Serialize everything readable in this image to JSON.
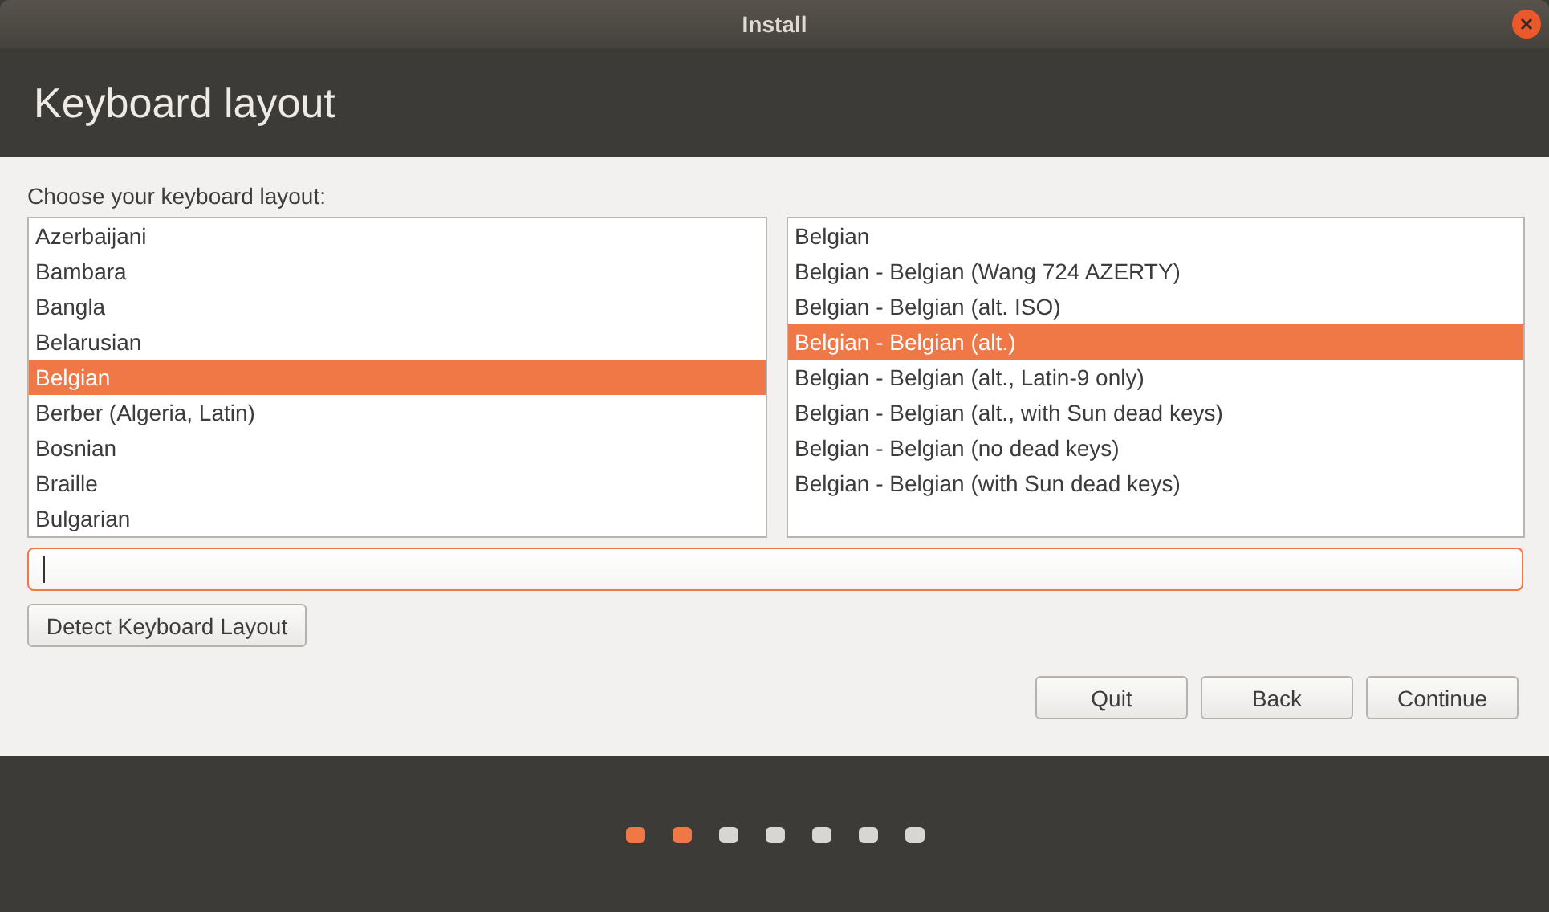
{
  "window": {
    "title": "Install"
  },
  "page_title": "Keyboard layout",
  "prompt": "Choose your keyboard layout:",
  "layouts": [
    {
      "label": "Azerbaijani",
      "selected": false
    },
    {
      "label": "Bambara",
      "selected": false
    },
    {
      "label": "Bangla",
      "selected": false
    },
    {
      "label": "Belarusian",
      "selected": false
    },
    {
      "label": "Belgian",
      "selected": true
    },
    {
      "label": "Berber (Algeria, Latin)",
      "selected": false
    },
    {
      "label": "Bosnian",
      "selected": false
    },
    {
      "label": "Braille",
      "selected": false
    },
    {
      "label": "Bulgarian",
      "selected": false
    }
  ],
  "variants": [
    {
      "label": "Belgian",
      "selected": false
    },
    {
      "label": "Belgian - Belgian (Wang 724 AZERTY)",
      "selected": false
    },
    {
      "label": "Belgian - Belgian (alt. ISO)",
      "selected": false
    },
    {
      "label": "Belgian - Belgian (alt.)",
      "selected": true
    },
    {
      "label": "Belgian - Belgian (alt., Latin-9 only)",
      "selected": false
    },
    {
      "label": "Belgian - Belgian (alt., with Sun dead keys)",
      "selected": false
    },
    {
      "label": "Belgian - Belgian (no dead keys)",
      "selected": false
    },
    {
      "label": "Belgian - Belgian (with Sun dead keys)",
      "selected": false
    }
  ],
  "test_field": {
    "focused": true
  },
  "detect_button": "Detect Keyboard Layout",
  "buttons": [
    "Quit",
    "Back",
    "Continue"
  ],
  "steps": [
    {
      "done": true
    },
    {
      "done": true
    },
    {
      "done": false
    },
    {
      "done": false
    },
    {
      "done": false
    },
    {
      "done": false
    },
    {
      "done": false
    }
  ]
}
